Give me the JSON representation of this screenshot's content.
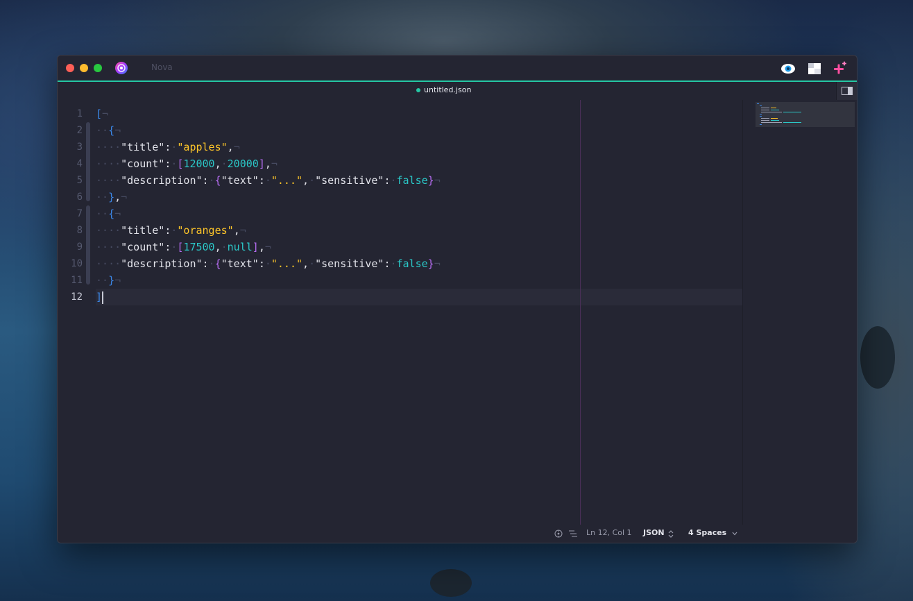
{
  "app": {
    "name": "Nova"
  },
  "tab": {
    "filename": "untitled.json",
    "modified": true
  },
  "editor": {
    "current_line": 12,
    "line_numbers": [
      "1",
      "2",
      "3",
      "4",
      "5",
      "6",
      "7",
      "8",
      "9",
      "10",
      "11",
      "12"
    ],
    "code": {
      "l1": {
        "open": "["
      },
      "l2": {
        "open": "{"
      },
      "l3": {
        "key": "\"title\"",
        "colon": ":",
        "value": "\"apples\"",
        "comma": ","
      },
      "l4": {
        "key": "\"count\"",
        "colon": ":",
        "open": "[",
        "n1": "12000",
        "comma1": ",",
        "n2": "20000",
        "close": "]",
        "comma": ","
      },
      "l5": {
        "key": "\"description\"",
        "colon": ":",
        "open": "{",
        "key2": "\"text\"",
        "colon2": ":",
        "val2": "\"...\"",
        "comma2": ",",
        "key3": "\"sensitive\"",
        "colon3": ":",
        "val3": "false",
        "close": "}"
      },
      "l6": {
        "close": "}",
        "comma": ","
      },
      "l7": {
        "open": "{"
      },
      "l8": {
        "key": "\"title\"",
        "colon": ":",
        "value": "\"oranges\"",
        "comma": ","
      },
      "l9": {
        "key": "\"count\"",
        "colon": ":",
        "open": "[",
        "n1": "17500",
        "comma1": ",",
        "n2": "null",
        "close": "]",
        "comma": ","
      },
      "l10": {
        "key": "\"description\"",
        "colon": ":",
        "open": "{",
        "key2": "\"text\"",
        "colon2": ":",
        "val2": "\"...\"",
        "comma2": ",",
        "key3": "\"sensitive\"",
        "colon3": ":",
        "val3": "false",
        "close": "}"
      },
      "l11": {
        "close": "}"
      },
      "l12": {
        "close": "]"
      }
    },
    "whitespace": {
      "space": "·",
      "newline": "¬"
    }
  },
  "statusbar": {
    "position": "Ln 12, Col 1",
    "syntax": "JSON",
    "syntax_chevron": "⌃⌄",
    "indentation": "4 Spaces",
    "indent_chevron": "⌄"
  },
  "icons": {
    "app_logo": "nova-logo-icon",
    "preview": "eye-icon",
    "layout": "layout-icon",
    "extensions": "sparkle-plus-icon",
    "sidebar_toggle": "sidebar-icon",
    "issues": "issues-icon",
    "symbols": "symbols-list-icon"
  },
  "colors": {
    "accent": "#25c7a4",
    "string": "#ffc629",
    "number": "#2bc8c8",
    "bracket_level1": "#3b87e8",
    "bracket_level2": "#b46cf0",
    "background": "#242532"
  }
}
